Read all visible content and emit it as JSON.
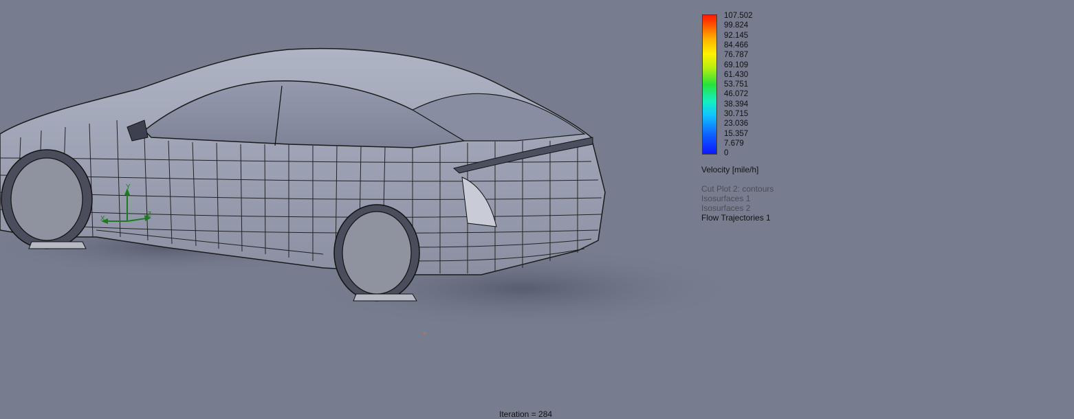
{
  "legend": {
    "colorbar_colors": [
      "#0b18ff",
      "#0d63ff",
      "#11c4ff",
      "#14f0c0",
      "#27e23c",
      "#b6ef10",
      "#fff200",
      "#ffb000",
      "#ff5200",
      "#ff1800"
    ],
    "ticks": [
      "107.502",
      "99.824",
      "92.145",
      "84.466",
      "76.787",
      "69.109",
      "61.430",
      "53.751",
      "46.072",
      "38.394",
      "30.715",
      "23.036",
      "15.357",
      "7.679",
      "0"
    ],
    "title": "Velocity [mile/h]"
  },
  "plots": [
    {
      "label": "Cut Plot 2: contours",
      "active": false
    },
    {
      "label": "Isosurfaces 1",
      "active": false
    },
    {
      "label": "Isosurfaces 2",
      "active": false
    },
    {
      "label": "Flow Trajectories 1",
      "active": true
    }
  ],
  "triad": {
    "x_label": "X",
    "y_label": "Y",
    "z_label": "Z"
  },
  "status": {
    "text": "Iteration = 284"
  },
  "origin_marker": "+"
}
